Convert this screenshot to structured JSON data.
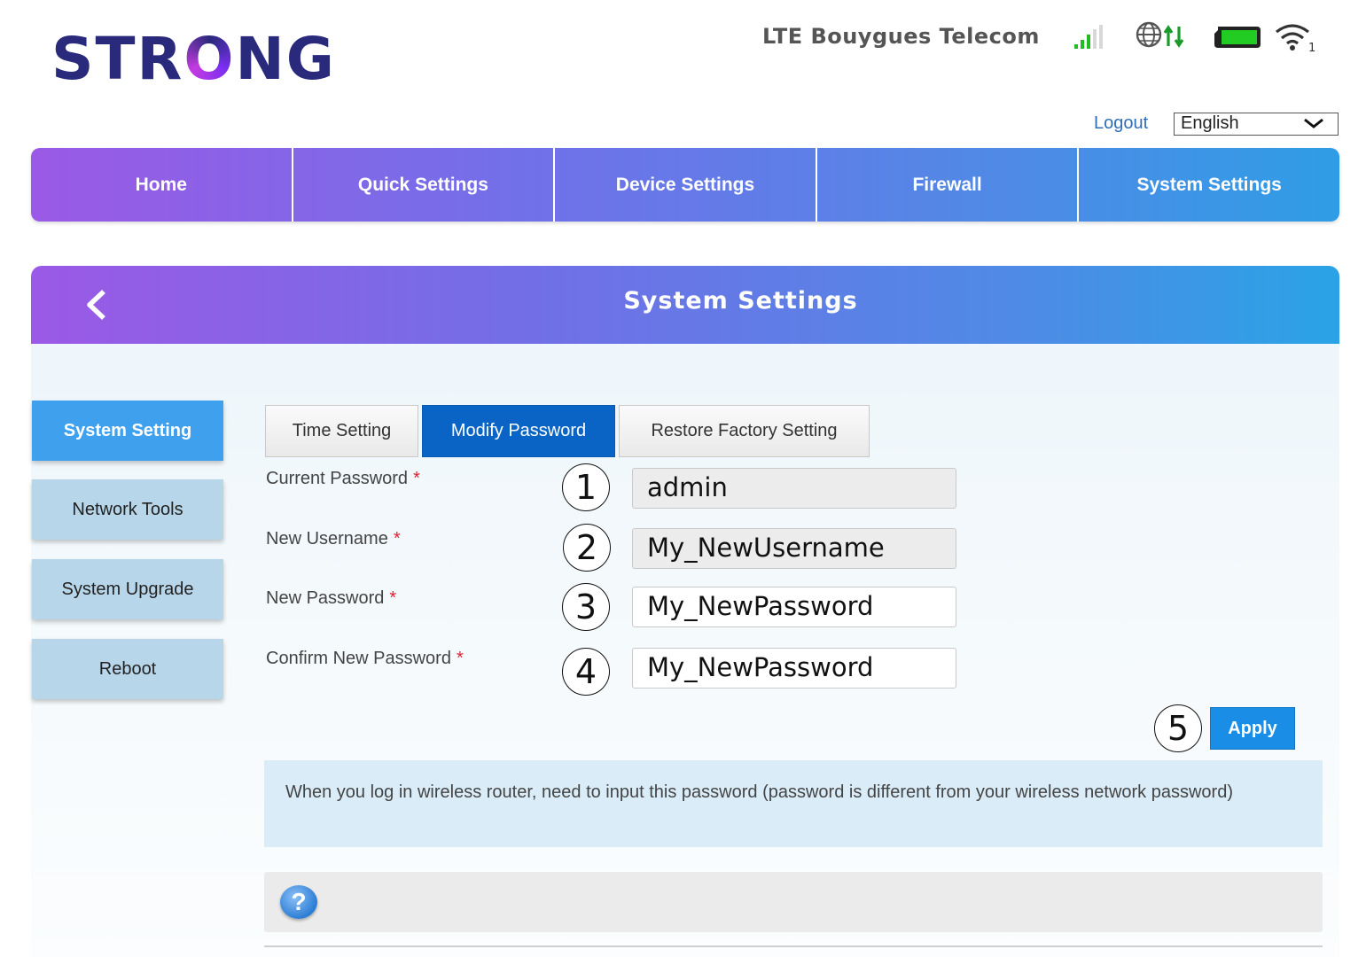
{
  "brand": {
    "logo_pre": "STR",
    "logo_o": "O",
    "logo_post": "NG"
  },
  "status": {
    "network": "LTE  Bouygues Telecom",
    "wifi_clients": "1"
  },
  "colors": {
    "accent": "#0a64c6",
    "apply": "#1a8de6",
    "active_side": "#3fa0ee",
    "side": "#b8d6ea",
    "battery": "#22cc22",
    "signal": "#22bb22"
  },
  "top": {
    "logout": "Logout",
    "language": "English"
  },
  "nav": [
    "Home",
    "Quick Settings",
    "Device Settings",
    "Firewall",
    "System Settings"
  ],
  "panel": {
    "title": "System Settings"
  },
  "sidebar": [
    "System Setting",
    "Network Tools",
    "System Upgrade",
    "Reboot"
  ],
  "tabs": [
    "Time Setting",
    "Modify Password",
    "Restore Factory Setting"
  ],
  "form": {
    "current_password": {
      "label": "Current Password",
      "value": "admin",
      "step": "1"
    },
    "new_username": {
      "label": "New Username",
      "value": "My_NewUsername",
      "step": "2"
    },
    "new_password": {
      "label": "New Password",
      "value": "My_NewPassword",
      "step": "3"
    },
    "confirm_password": {
      "label": "Confirm New Password",
      "value": "My_NewPassword",
      "step": "4"
    },
    "required_mark": "*"
  },
  "apply": {
    "label": "Apply",
    "step": "5"
  },
  "info": "When you log in wireless router, need to input this password (password is different from your wireless network password)",
  "help": {
    "icon_glyph": "?"
  }
}
